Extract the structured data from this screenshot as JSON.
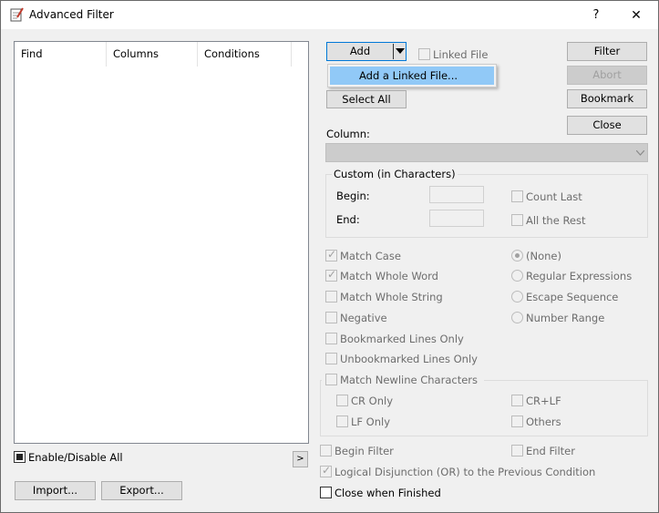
{
  "window": {
    "title": "Advanced Filter",
    "help": "?",
    "close": "✕"
  },
  "list": {
    "columns": [
      "Find",
      "Columns",
      "Conditions"
    ]
  },
  "left": {
    "enable_all": "Enable/Disable All",
    "more": ">",
    "import": "Import...",
    "export": "Export..."
  },
  "top": {
    "add": "Add",
    "linked_file": "Linked File",
    "menu_item": "Add a Linked File...",
    "select_all": "Select All"
  },
  "right_buttons": {
    "filter": "Filter",
    "abort": "Abort",
    "bookmark": "Bookmark",
    "close": "Close"
  },
  "column_label": "Column:",
  "custom": {
    "title": "Custom (in Characters)",
    "begin": "Begin:",
    "end": "End:",
    "count_last": "Count Last",
    "all_rest": "All the Rest"
  },
  "options": {
    "match_case": "Match Case",
    "match_whole_word": "Match Whole Word",
    "match_whole_string": "Match Whole String",
    "negative": "Negative",
    "bookmarked_only": "Bookmarked Lines Only",
    "unbookmarked_only": "Unbookmarked Lines Only",
    "match_newline": "Match Newline Characters",
    "cr_only": "CR Only",
    "lf_only": "LF Only",
    "crlf": "CR+LF",
    "others": "Others"
  },
  "radios": {
    "none": "(None)",
    "regex": "Regular Expressions",
    "escape": "Escape Sequence",
    "number_range": "Number Range"
  },
  "bottom": {
    "begin_filter": "Begin Filter",
    "end_filter": "End Filter",
    "logical_or": "Logical Disjunction (OR) to the Previous Condition",
    "close_when_finished": "Close when Finished"
  }
}
